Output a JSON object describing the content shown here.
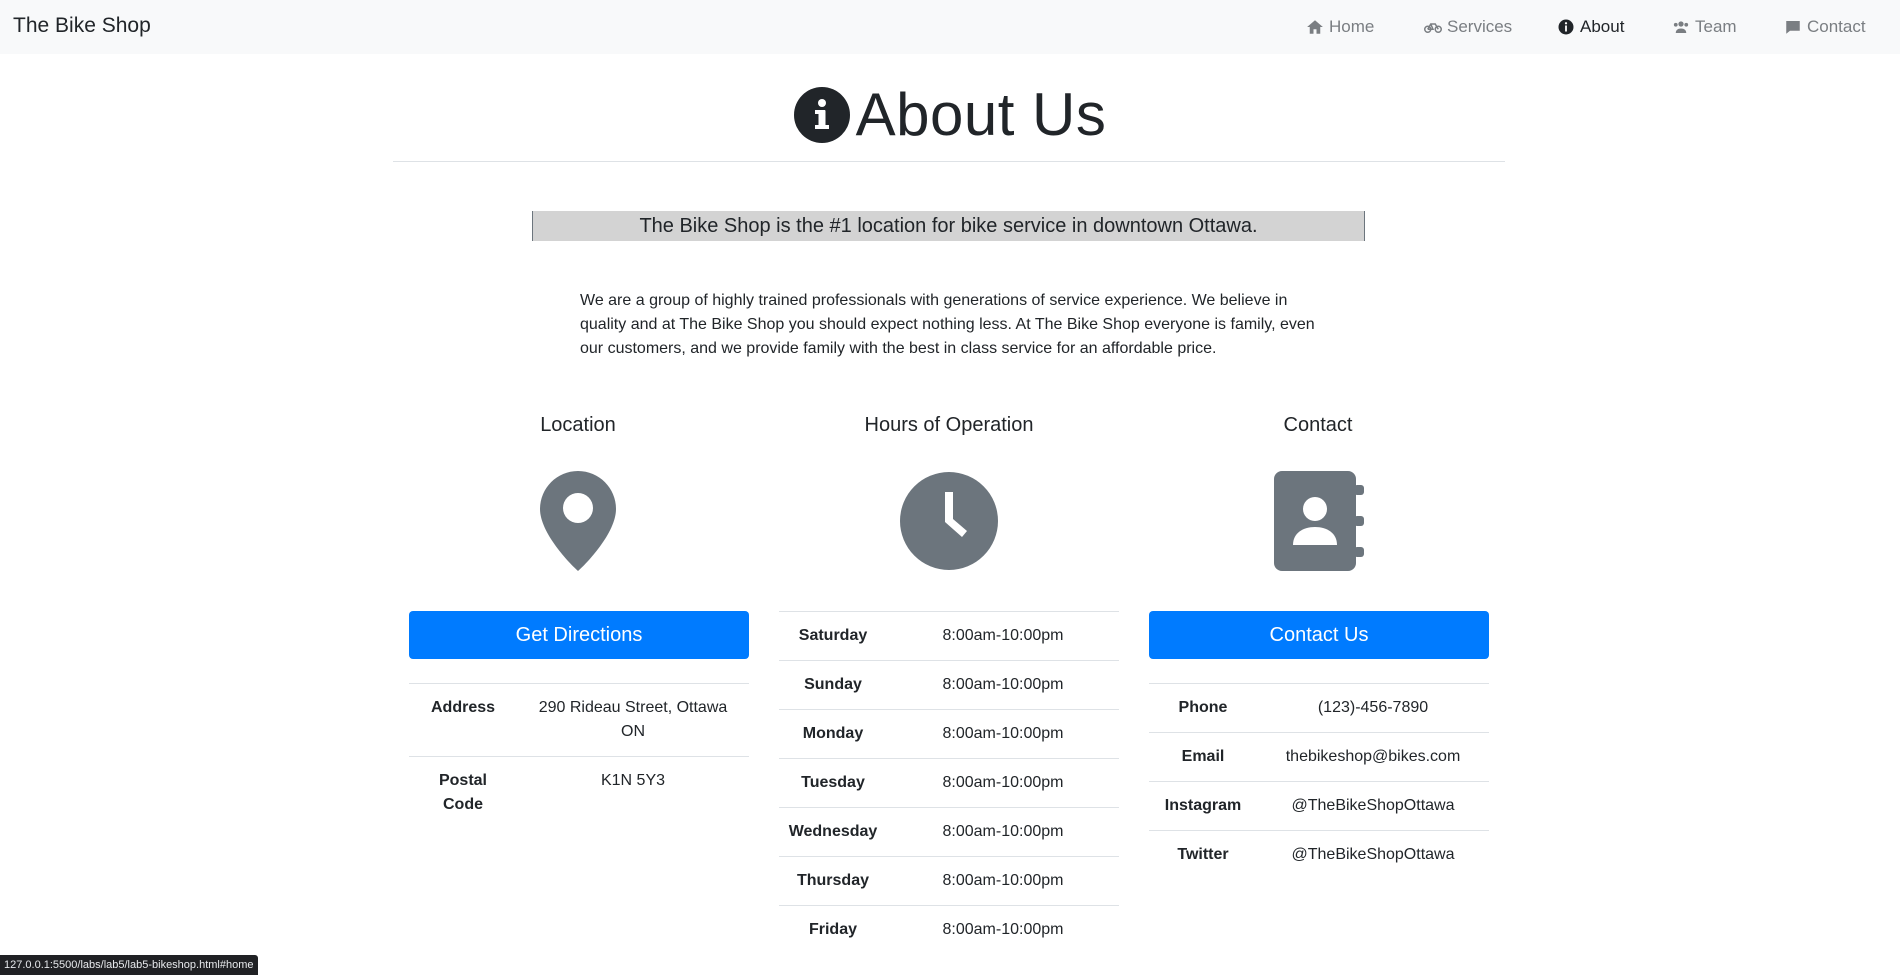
{
  "navbar": {
    "brand": "The Bike Shop",
    "links": [
      {
        "label": "Home",
        "icon": "home-icon"
      },
      {
        "label": "Services",
        "icon": "bicycle-icon"
      },
      {
        "label": "About",
        "icon": "info-circle-icon",
        "active": true
      },
      {
        "label": "Team",
        "icon": "users-icon"
      },
      {
        "label": "Contact",
        "icon": "comment-icon"
      }
    ]
  },
  "header": {
    "title": "About Us",
    "icon": "info-circle-icon"
  },
  "lead": "The Bike Shop is the #1 location for bike service in downtown Ottawa.",
  "intro": "We are a group of highly trained professionals with generations of service experience. We believe in quality and at The Bike Shop you should expect nothing less. At The Bike Shop everyone is family, even our customers, and we provide family with the best in class service for an affordable price.",
  "location": {
    "title": "Location",
    "icon": "map-marker-icon",
    "button": "Get Directions",
    "rows": [
      {
        "key": "Address",
        "value": "290 Rideau Street, Ottawa ON"
      },
      {
        "key": "Postal Code",
        "value": "K1N 5Y3"
      }
    ]
  },
  "hours": {
    "title": "Hours of Operation",
    "icon": "clock-icon",
    "rows": [
      {
        "key": "Saturday",
        "value": "8:00am-10:00pm"
      },
      {
        "key": "Sunday",
        "value": "8:00am-10:00pm"
      },
      {
        "key": "Monday",
        "value": "8:00am-10:00pm"
      },
      {
        "key": "Tuesday",
        "value": "8:00am-10:00pm"
      },
      {
        "key": "Wednesday",
        "value": "8:00am-10:00pm"
      },
      {
        "key": "Thursday",
        "value": "8:00am-10:00pm"
      },
      {
        "key": "Friday",
        "value": "8:00am-10:00pm"
      }
    ]
  },
  "contact": {
    "title": "Contact",
    "icon": "address-book-icon",
    "button": "Contact Us",
    "rows": [
      {
        "key": "Phone",
        "value": "(123)-456-7890"
      },
      {
        "key": "Email",
        "value": "thebikeshop@bikes.com"
      },
      {
        "key": "Instagram",
        "value": "@TheBikeShopOttawa"
      },
      {
        "key": "Twitter",
        "value": "@TheBikeShopOttawa"
      }
    ]
  },
  "status_bar": "127.0.0.1:5500/labs/lab5/lab5-bikeshop.html#home",
  "colors": {
    "primary": "#007bff",
    "icon_gray": "#6c757d",
    "lead_bg": "#d3d3d3"
  }
}
